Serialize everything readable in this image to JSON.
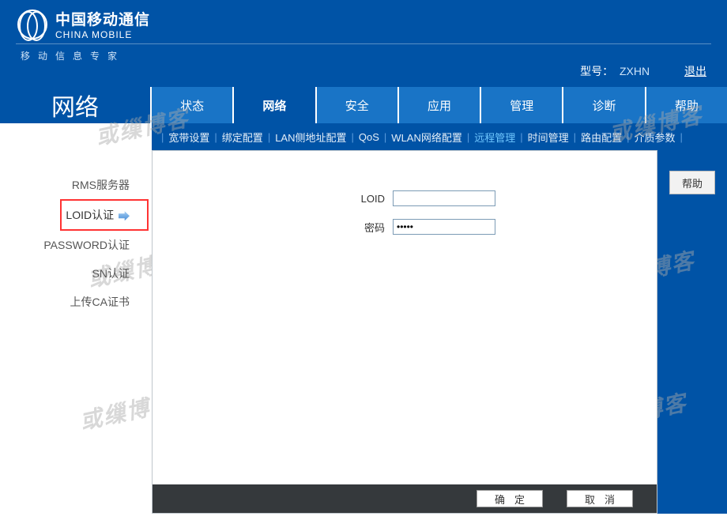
{
  "watermark_text": "或缫博客",
  "header": {
    "brand_cn": "中国移动通信",
    "brand_en": "CHINA MOBILE",
    "brand_sub": "移动信息专家",
    "model_label": "型号：",
    "model_value": "ZXHN",
    "logout": "退出"
  },
  "section_title": "网络",
  "tabs": [
    {
      "label": "状态",
      "active": false
    },
    {
      "label": "网络",
      "active": true
    },
    {
      "label": "安全",
      "active": false
    },
    {
      "label": "应用",
      "active": false
    },
    {
      "label": "管理",
      "active": false
    },
    {
      "label": "诊断",
      "active": false
    },
    {
      "label": "帮助",
      "active": false
    }
  ],
  "subnav": [
    {
      "label": "宽带设置",
      "active": false
    },
    {
      "label": "绑定配置",
      "active": false
    },
    {
      "label": "LAN侧地址配置",
      "active": false
    },
    {
      "label": "QoS",
      "active": false
    },
    {
      "label": "WLAN网络配置",
      "active": false
    },
    {
      "label": "远程管理",
      "active": true
    },
    {
      "label": "时间管理",
      "active": false
    },
    {
      "label": "路由配置",
      "active": false
    },
    {
      "label": "介质参数",
      "active": false
    }
  ],
  "sidebar": [
    {
      "label": "RMS服务器",
      "selected": false
    },
    {
      "label": "LOID认证",
      "selected": true
    },
    {
      "label": "PASSWORD认证",
      "selected": false
    },
    {
      "label": "SN认证",
      "selected": false
    },
    {
      "label": "上传CA证书",
      "selected": false
    }
  ],
  "form": {
    "loid_label": "LOID",
    "loid_value": "",
    "password_label": "密码",
    "password_value": "•••••"
  },
  "buttons": {
    "help": "帮助",
    "ok": "确定",
    "cancel": "取消"
  }
}
